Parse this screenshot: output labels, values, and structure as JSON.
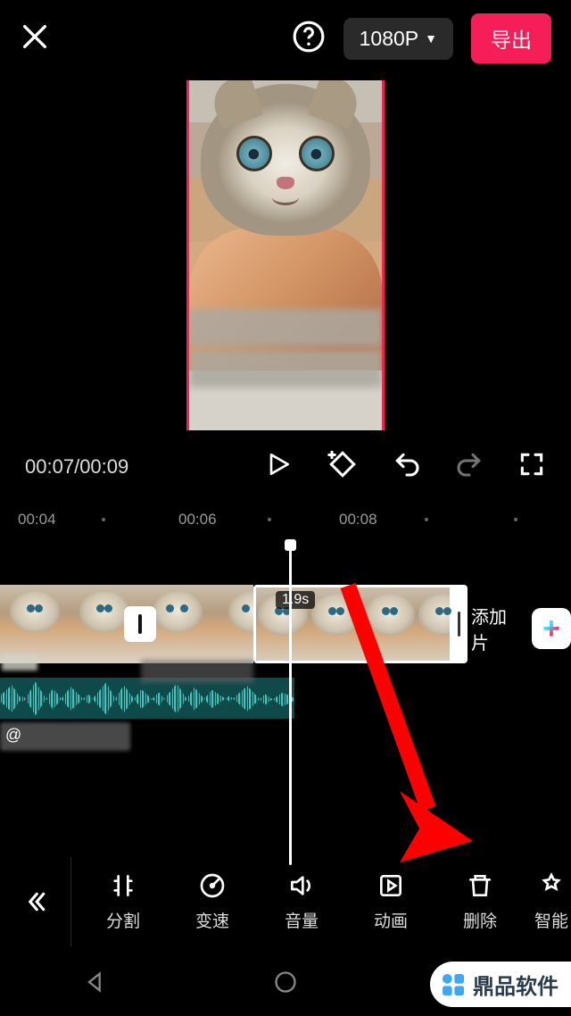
{
  "header": {
    "resolution_label": "1080P",
    "export_label": "导出"
  },
  "playback": {
    "current_time": "00:07",
    "total_time": "00:09"
  },
  "ruler": {
    "marks": [
      "00:04",
      "00:06",
      "00:08"
    ]
  },
  "timeline": {
    "selected_clip_duration": "1.9s",
    "add_segment_label": "添加片",
    "creator_prefix": "@"
  },
  "toolbar": {
    "items": [
      {
        "id": "split",
        "label": "分割"
      },
      {
        "id": "speed",
        "label": "变速"
      },
      {
        "id": "volume",
        "label": "音量"
      },
      {
        "id": "anim",
        "label": "动画"
      },
      {
        "id": "delete",
        "label": "删除"
      },
      {
        "id": "smart",
        "label": "智能"
      }
    ]
  },
  "watermark": {
    "text": "鼎品软件"
  }
}
